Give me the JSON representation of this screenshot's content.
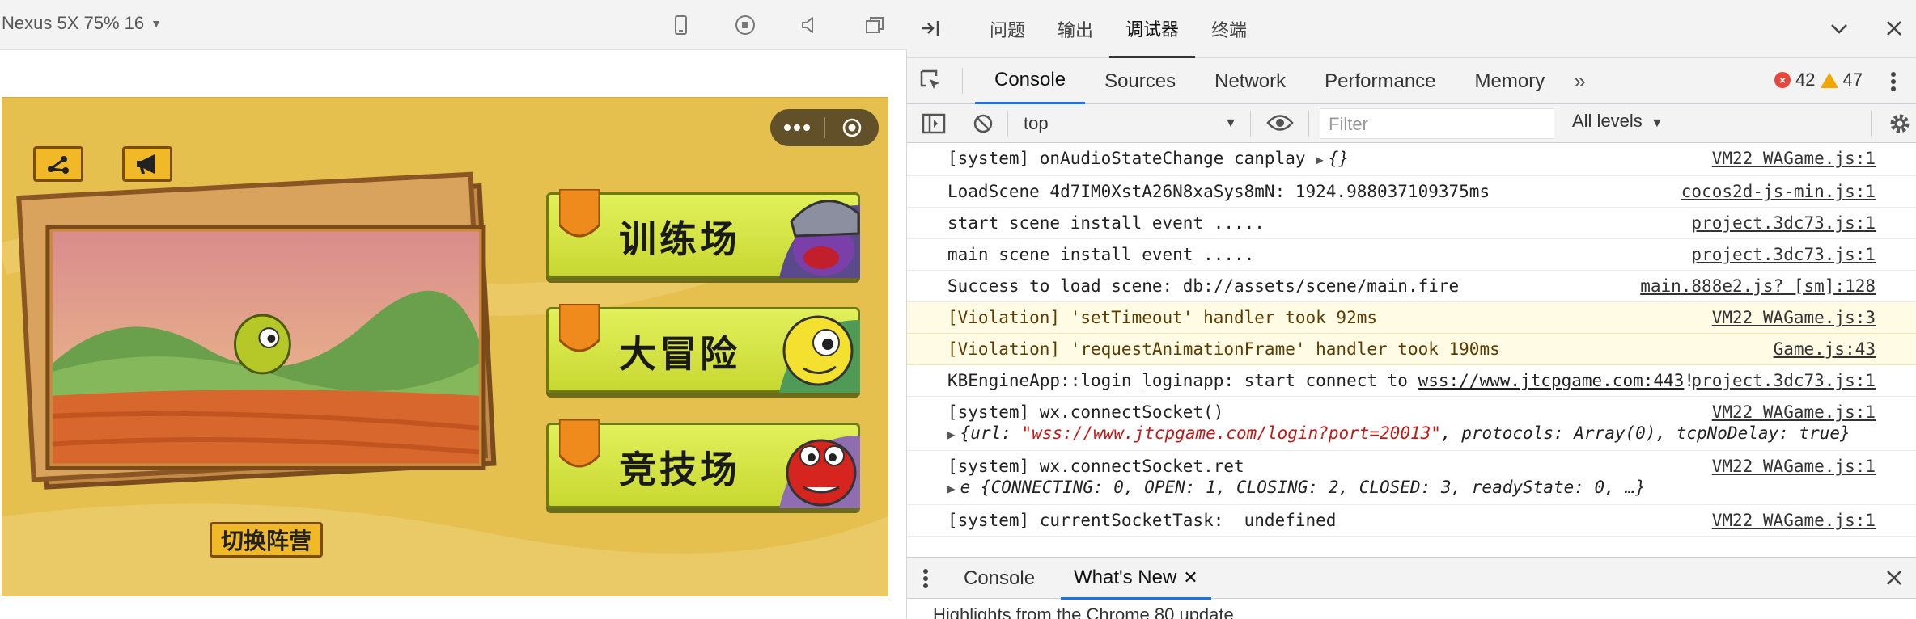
{
  "simulator": {
    "device_label": "Nexus 5X 75% 16",
    "icons": [
      "phone-icon",
      "record-icon",
      "volume-icon",
      "popout-icon"
    ]
  },
  "game": {
    "menu_buttons": [
      {
        "label": "训练场",
        "accent": "#5a4a8c"
      },
      {
        "label": "大冒险",
        "accent": "#4f9a55"
      },
      {
        "label": "竞技场",
        "accent": "#8e6eb0"
      }
    ],
    "switch_label": "切换阵营",
    "colors": {
      "background": "#e5be4d",
      "button": "#d6e645",
      "frame": "#c9914a"
    }
  },
  "devtools": {
    "top_tabs": [
      "问题",
      "输出",
      "调试器",
      "终端"
    ],
    "active_top_tab": "调试器",
    "panel_tabs": [
      "Console",
      "Sources",
      "Network",
      "Performance",
      "Memory"
    ],
    "more_tabs": "»",
    "error_count": "42",
    "warning_count": "47",
    "context": "top",
    "filter_placeholder": "Filter",
    "levels": "All levels",
    "console_rows": [
      {
        "msg": "[system] onAudioStateChange canplay ",
        "obj": "{}",
        "src": "VM22 WAGame.js:1"
      },
      {
        "msg": "LoadScene 4d7IM0XstA26N8xaSys8mN: 1924.988037109375ms",
        "src": "cocos2d-js-min.js:1"
      },
      {
        "msg": "start scene install event .....",
        "src": "project.3dc73.js:1"
      },
      {
        "msg": "main scene install event .....",
        "src": "project.3dc73.js:1"
      },
      {
        "msg": "Success to load scene: db://assets/scene/main.fire",
        "src": "main.888e2.js? [sm]:128"
      },
      {
        "msg": "[Violation] 'setTimeout' handler took 92ms",
        "src": "VM22 WAGame.js:3"
      },
      {
        "msg": "[Violation] 'requestAnimationFrame' handler took 190ms",
        "src": "Game.js:43"
      },
      {
        "msg": "KBEngineApp::login_loginapp: start connect to ",
        "link": "wss://www.jtcpgame.com:443",
        "tail": "!",
        "src": "project.3dc73.js:1"
      },
      {
        "msg": "[system] wx.connectSocket()",
        "src": "VM22 WAGame.js:1"
      },
      {
        "msg": "[system] wx.connectSocket.ret",
        "src": "VM22 WAGame.js:1"
      },
      {
        "msg": "[system] currentSocketTask:  undefined",
        "src": "VM22 WAGame.js:1"
      }
    ],
    "connect_obj": {
      "url_key": "url",
      "url_val": "\"wss://www.jtcpgame.com/login?port=20013\"",
      "protocols": "protocols: Array(0), tcpNoDelay: true"
    },
    "ret_obj": "e {CONNECTING: 0, OPEN: 1, CLOSING: 2, CLOSED: 3, readyState: 0, …}",
    "drawer_tabs": [
      "Console",
      "What's New"
    ],
    "drawer_note": "Highlights from the Chrome 80 update"
  }
}
